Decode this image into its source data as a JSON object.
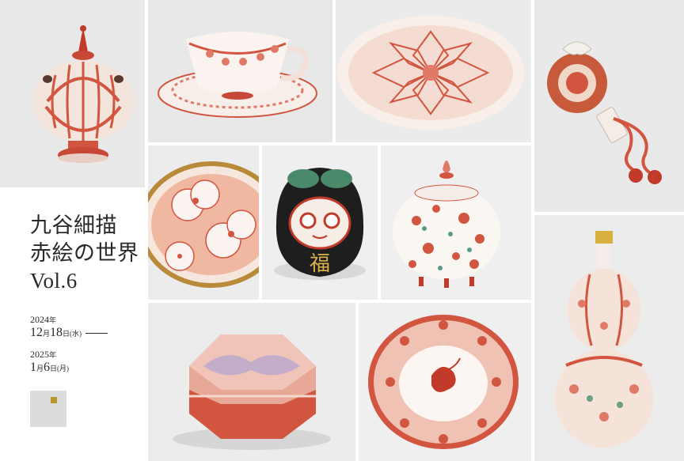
{
  "title": {
    "line1": "九谷細描",
    "line2": "赤絵の世界",
    "line3": "Vol.6"
  },
  "dates": {
    "start": {
      "year": "2024",
      "year_unit": "年",
      "month": "12",
      "month_unit": "月",
      "day": "18",
      "day_unit": "日",
      "weekday": "(水)"
    },
    "end": {
      "year": "2025",
      "year_unit": "年",
      "month": "1",
      "month_unit": "月",
      "day": "6",
      "day_unit": "日",
      "weekday": "(月)"
    }
  },
  "daruma_text": "福",
  "colors": {
    "accent_red": "#d2553f",
    "gold": "#b8962e",
    "background": "#ffffff"
  }
}
